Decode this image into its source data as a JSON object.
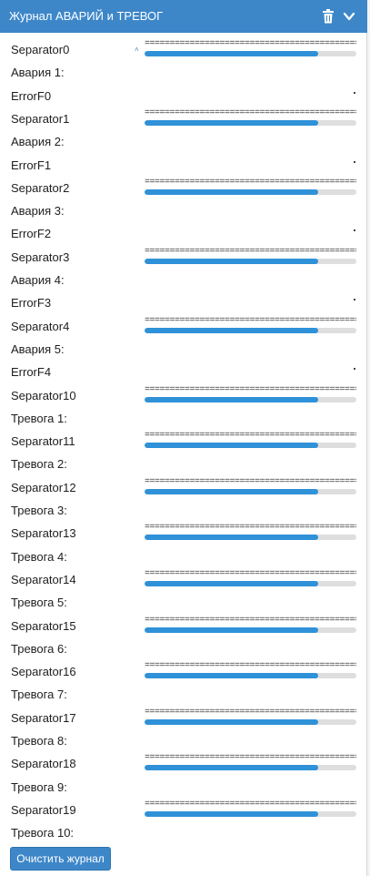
{
  "panel": {
    "title": "Журнал АВАРИЙ и ТРЕВОГ",
    "accent_color": "#3d87c9",
    "bar_color": "#2f91d8",
    "icons": [
      "trash-icon",
      "chevron-down-icon"
    ],
    "rule_text": "================================================",
    "clear_button": "Очистить журнал",
    "rows": [
      {
        "label": "Separator0",
        "type": "separator",
        "progress": 0.82
      },
      {
        "label": "Авария 1:",
        "type": "label"
      },
      {
        "label": "ErrorF0",
        "type": "error"
      },
      {
        "label": "Separator1",
        "type": "separator",
        "progress": 0.82
      },
      {
        "label": "Авария 2:",
        "type": "label"
      },
      {
        "label": "ErrorF1",
        "type": "error"
      },
      {
        "label": "Separator2",
        "type": "separator",
        "progress": 0.82
      },
      {
        "label": "Авария 3:",
        "type": "label"
      },
      {
        "label": "ErrorF2",
        "type": "error"
      },
      {
        "label": "Separator3",
        "type": "separator",
        "progress": 0.82
      },
      {
        "label": "Авария 4:",
        "type": "label"
      },
      {
        "label": "ErrorF3",
        "type": "error"
      },
      {
        "label": "Separator4",
        "type": "separator",
        "progress": 0.82
      },
      {
        "label": "Авария 5:",
        "type": "label"
      },
      {
        "label": "ErrorF4",
        "type": "error"
      },
      {
        "label": "Separator10",
        "type": "separator",
        "progress": 0.82
      },
      {
        "label": "Тревога 1:",
        "type": "label"
      },
      {
        "label": "Separator11",
        "type": "separator",
        "progress": 0.82
      },
      {
        "label": "Тревога 2:",
        "type": "label"
      },
      {
        "label": "Separator12",
        "type": "separator",
        "progress": 0.82
      },
      {
        "label": "Тревога 3:",
        "type": "label"
      },
      {
        "label": "Separator13",
        "type": "separator",
        "progress": 0.82
      },
      {
        "label": "Тревога 4:",
        "type": "label"
      },
      {
        "label": "Separator14",
        "type": "separator",
        "progress": 0.82
      },
      {
        "label": "Тревога 5:",
        "type": "label"
      },
      {
        "label": "Separator15",
        "type": "separator",
        "progress": 0.82
      },
      {
        "label": "Тревога 6:",
        "type": "label"
      },
      {
        "label": "Separator16",
        "type": "separator",
        "progress": 0.82
      },
      {
        "label": "Тревога 7:",
        "type": "label"
      },
      {
        "label": "Separator17",
        "type": "separator",
        "progress": 0.82
      },
      {
        "label": "Тревога 8:",
        "type": "label"
      },
      {
        "label": "Separator18",
        "type": "separator",
        "progress": 0.82
      },
      {
        "label": "Тревога 9:",
        "type": "label"
      },
      {
        "label": "Separator19",
        "type": "separator",
        "progress": 0.82
      },
      {
        "label": "Тревога 10:",
        "type": "label"
      }
    ]
  }
}
